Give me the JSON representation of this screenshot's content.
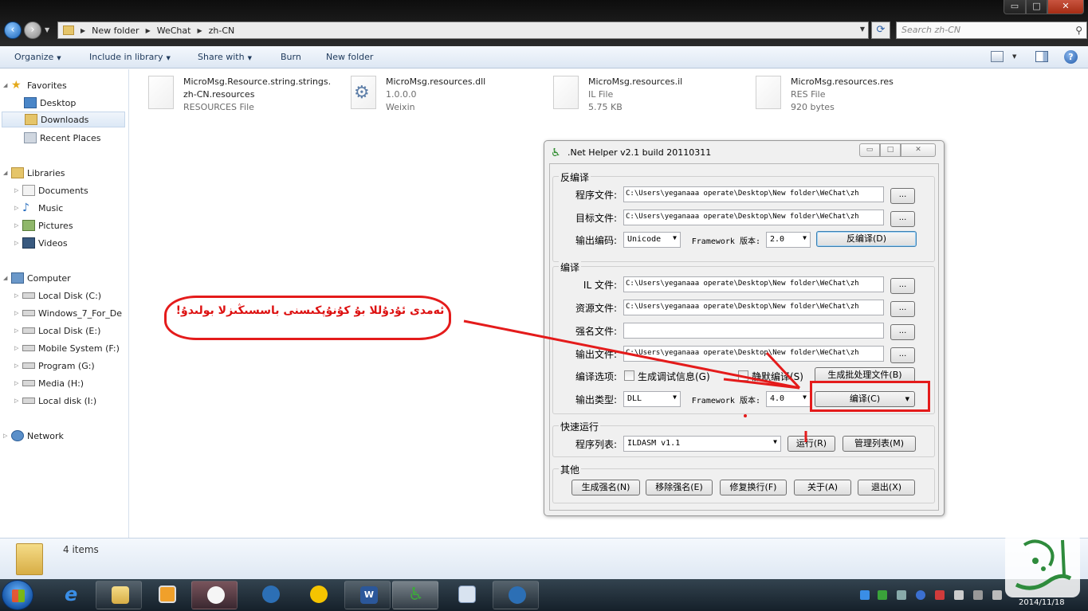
{
  "window": {
    "address": [
      "New folder",
      "WeChat",
      "zh-CN"
    ],
    "search_placeholder": "Search zh-CN",
    "caption_buttons": {
      "minimize": "▭",
      "maximize": "□",
      "close": "✕"
    }
  },
  "commands": [
    {
      "label": "Organize",
      "dropdown": true
    },
    {
      "label": "Include in library",
      "dropdown": true
    },
    {
      "label": "Share with",
      "dropdown": true
    },
    {
      "label": "Burn",
      "dropdown": false
    },
    {
      "label": "New folder",
      "dropdown": false
    }
  ],
  "nav": {
    "favorites": {
      "label": "Favorites",
      "items": [
        "Desktop",
        "Downloads",
        "Recent Places"
      ]
    },
    "libraries": {
      "label": "Libraries",
      "items": [
        "Documents",
        "Music",
        "Pictures",
        "Videos"
      ]
    },
    "computer": {
      "label": "Computer",
      "items": [
        "Local Disk (C:)",
        "Windows_7_For_De",
        "Local Disk (E:)",
        "Mobile System (F:)",
        "Program (G:)",
        "Media (H:)",
        "Local disk (I:)"
      ]
    },
    "network": {
      "label": "Network"
    }
  },
  "files": [
    {
      "name1": "MicroMsg.Resource.string.strings.",
      "name2": "zh-CN.resources",
      "type": "RESOURCES File",
      "icon": "document-icon"
    },
    {
      "name1": "MicroMsg.resources.dll",
      "name2": "1.0.0.0",
      "type": "Weixin",
      "icon": "dll-gear-icon"
    },
    {
      "name1": "MicroMsg.resources.il",
      "name2": "IL File",
      "type": "5.75 KB",
      "icon": "document-icon"
    },
    {
      "name1": "MicroMsg.resources.res",
      "name2": "RES File",
      "type": "920 bytes",
      "icon": "document-icon"
    }
  ],
  "status": {
    "items": "4 items"
  },
  "dialog": {
    "title": ".Net Helper v2.1 build 20110311",
    "decompile": {
      "group": "反编译",
      "program_file_label": "程序文件:",
      "program_file": "C:\\Users\\yeganaaa operate\\Desktop\\New folder\\WeChat\\zh",
      "target_file_label": "目标文件:",
      "target_file": "C:\\Users\\yeganaaa operate\\Desktop\\New folder\\WeChat\\zh",
      "encoding_label": "输出编码:",
      "encoding": "Unicode",
      "framework_label": "Framework 版本:",
      "framework": "2.0",
      "action": "反编译(D)"
    },
    "compile": {
      "group": "编译",
      "il_label": "IL 文件:",
      "il_file": "C:\\Users\\yeganaaa operate\\Desktop\\New folder\\WeChat\\zh",
      "res_label": "资源文件:",
      "res_file": "C:\\Users\\yeganaaa operate\\Desktop\\New folder\\WeChat\\zh",
      "strongname_label": "强名文件:",
      "strongname_file": "",
      "output_label": "输出文件:",
      "output_file": "C:\\Users\\yeganaaa operate\\Desktop\\New folder\\WeChat\\zh",
      "options_label": "编译选项:",
      "debug_info": "生成调试信息(G)",
      "quiet": "静默编译(S)",
      "batch": "生成批处理文件(B)",
      "type_label": "输出类型:",
      "type": "DLL",
      "framework_label": "Framework 版本:",
      "framework": "4.0",
      "action": "编译(C)"
    },
    "quickrun": {
      "group": "快速运行",
      "list_label": "程序列表:",
      "program": "ILDASM v1.1",
      "run": "运行(R)",
      "manage": "管理列表(M)"
    },
    "other": {
      "group": "其他",
      "buttons": [
        "生成强名(N)",
        "移除强名(E)",
        "修复换行(F)",
        "关于(A)",
        "退出(X)"
      ]
    },
    "ellipsis": "...",
    "caption_buttons": {
      "minimize": "▭",
      "maximize": "□",
      "close": "✕"
    }
  },
  "annotation": {
    "text": "ئەمدى ئۇدۇللا بۇ كۇنۇپكىسنى باسسىڭىزلا بولىدۇ!",
    "color": "#e41b1b"
  },
  "taskbar": {
    "apps": [
      "explorer-icon",
      "media-player-icon",
      "paint-icon",
      "owl-icon",
      "app-icon",
      "word-icon",
      "net-helper-icon",
      "app2-icon",
      "owl2-icon"
    ],
    "clock": "2014/11/18"
  }
}
